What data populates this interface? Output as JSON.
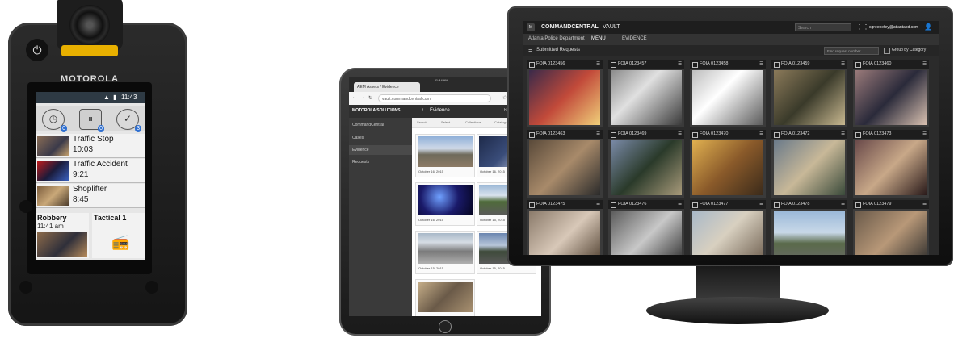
{
  "phone": {
    "brand": "MOTOROLA",
    "status_time": "11:43",
    "icon_badges": [
      "0",
      "0",
      "3"
    ],
    "incidents": [
      {
        "title": "Traffic Stop",
        "time": "10:03"
      },
      {
        "title": "Traffic Accident",
        "time": "9:21"
      },
      {
        "title": "Shoplifter",
        "time": "8:45"
      }
    ],
    "tiles": [
      {
        "title": "Robbery",
        "time": "11:41 am"
      },
      {
        "title": "Tactical 1",
        "time": ""
      }
    ]
  },
  "tablet": {
    "status_time": "11:44 AM",
    "tab_label": "AEM Assets / Evidence",
    "url": "vault.commandcentral.com",
    "brand": "MOTOROLA SOLUTIONS",
    "page_title": "Evidence",
    "help_label": "Help",
    "sidebar": [
      "CommandCentral",
      "Cases",
      "Evidence",
      "Requests"
    ],
    "toolbar": [
      "Search",
      "Select",
      "Collections",
      "Catalogs"
    ],
    "cards": [
      {
        "caption": "October 16, 2015"
      },
      {
        "caption": "October 16, 2015"
      },
      {
        "caption": "October 16, 2015"
      },
      {
        "caption": "October 15, 2015"
      },
      {
        "caption": "October 15, 2015"
      },
      {
        "caption": "October 15, 2015"
      },
      {
        "caption": ""
      }
    ]
  },
  "monitor": {
    "product": "COMMANDCENTRAL",
    "module": "VAULT",
    "search_placeholder": "Search",
    "user_email": "sgreenefey@atlantapd.com",
    "department": "Atlanta Police Department",
    "menu_label": "MENU",
    "evidence_label": "EVIDENCE",
    "section_title": "Submitted Requests",
    "find_placeholder": "Find request number",
    "group_label": "Group by Category",
    "requests": [
      "FOIA 0123456",
      "FOIA 0123457",
      "FOIA 0123458",
      "FOIA 0123459",
      "FOIA 0123460",
      "FOIA 0123463",
      "FOIA 0123469",
      "FOIA 0123470",
      "FOIA 0123472",
      "FOIA 0123473",
      "FOIA 0123475",
      "FOIA 0123476",
      "FOIA 0123477",
      "FOIA 0123478",
      "FOIA 0123479"
    ]
  }
}
